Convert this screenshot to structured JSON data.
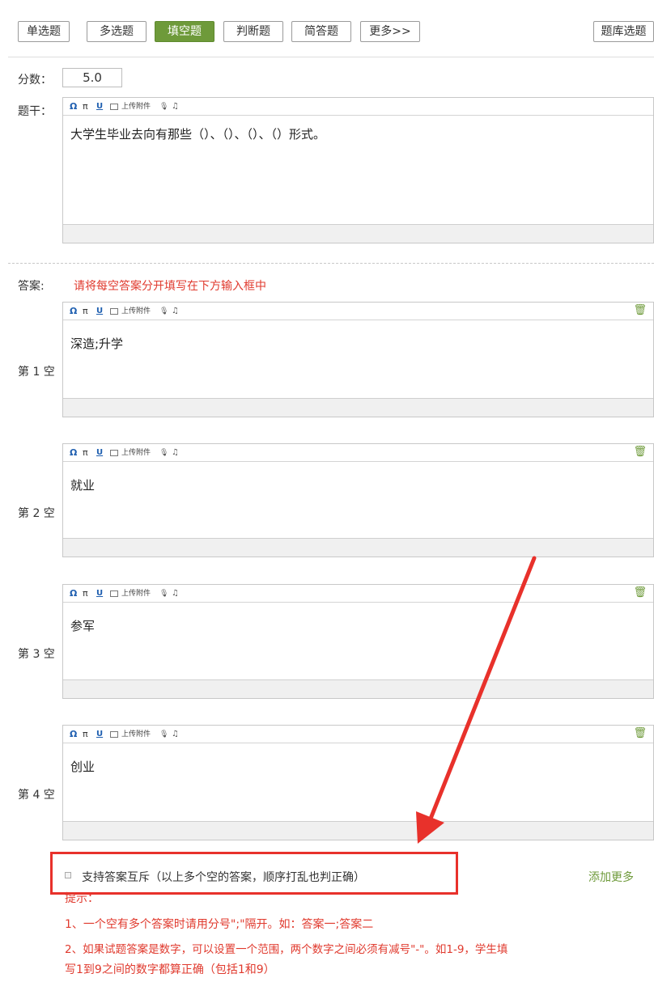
{
  "question_types": [
    "单选题",
    "多选题",
    "填空题",
    "判断题",
    "简答题",
    "更多>>"
  ],
  "active_type": "填空题",
  "question_bank_label": "题库选题",
  "score": {
    "label": "分数：",
    "value": "5.0"
  },
  "stem": {
    "label": "题干：",
    "text": "大学生毕业去向有那些（）、（）、（）、（）形式。"
  },
  "toolbar": {
    "omega": "Ω",
    "pi": "π",
    "underline": "U",
    "attach": "上传附件",
    "mic": "🎙",
    "music": "♫",
    "trash": "🗑"
  },
  "answers": {
    "label": "答案:",
    "instruction": "请将每空答案分开填写在下方输入框中",
    "blanks": [
      {
        "label": "第 1 空",
        "text": "深造;升学"
      },
      {
        "label": "第 2 空",
        "text": "就业"
      },
      {
        "label": "第 3 空",
        "text": "参军"
      },
      {
        "label": "第 4 空",
        "text": "创业"
      }
    ]
  },
  "mutual_exclusion": {
    "label": "支持答案互斥（以上多个空的答案，顺序打乱也判正确）",
    "checked": false
  },
  "add_more_label": "添加更多",
  "tips": {
    "title": "提示：",
    "line1": "1、一个空有多个答案时请用分号\";\"隔开。如：答案一;答案二",
    "line2a": "2、如果试题答案是数字，可以设置一个范围，两个数字之间必须有减号\"-\"。如1-9，学生填",
    "line2b": "写1到9之间的数字都算正确（包括1和9）"
  },
  "colors": {
    "accent_green": "#6e9a3a",
    "alert_red": "#e03a2e",
    "highlight_red": "#e8312b"
  }
}
